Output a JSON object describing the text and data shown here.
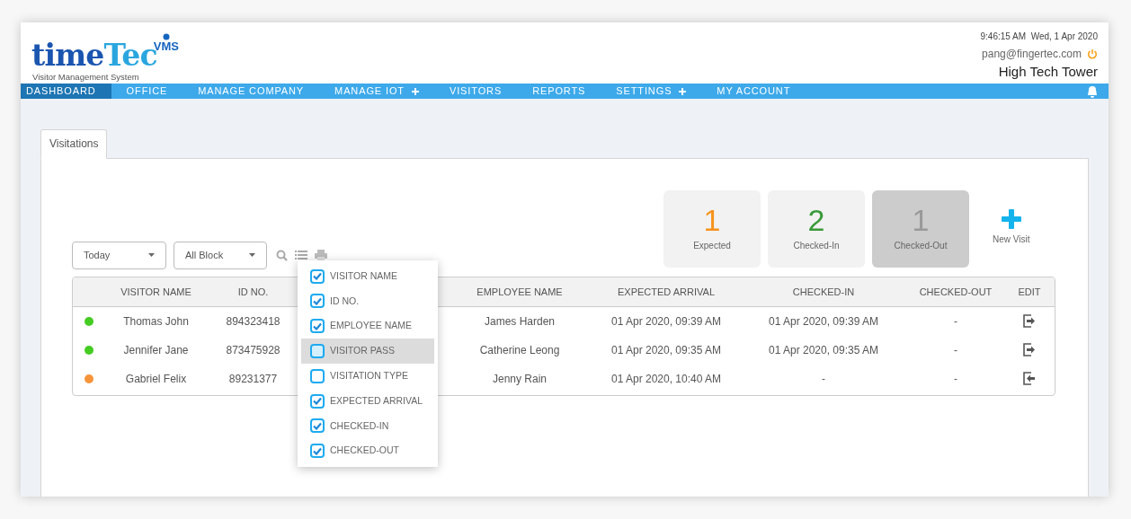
{
  "logo": {
    "word_dark": "time",
    "word_light": "Tec",
    "badge": "VMS",
    "subtitle": "Visitor Management System"
  },
  "header": {
    "datetime": "9:46:15 AM  Wed, 1 Apr 2020",
    "email": "pang@fingertec.com",
    "site": "High Tech Tower"
  },
  "nav": [
    {
      "label": "DASHBOARD",
      "selected": true,
      "expandable": false
    },
    {
      "label": "OFFICE",
      "selected": false,
      "expandable": false
    },
    {
      "label": "MANAGE COMPANY",
      "selected": false,
      "expandable": false
    },
    {
      "label": "MANAGE IOT",
      "selected": false,
      "expandable": true
    },
    {
      "label": "VISITORS",
      "selected": false,
      "expandable": false
    },
    {
      "label": "REPORTS",
      "selected": false,
      "expandable": false
    },
    {
      "label": "SETTINGS",
      "selected": false,
      "expandable": true
    },
    {
      "label": "MY ACCOUNT",
      "selected": false,
      "expandable": false
    }
  ],
  "tabs": [
    {
      "label": "Visitations",
      "selected": true
    }
  ],
  "stats": [
    {
      "count": "1",
      "label": "Expected",
      "color": "#f7931e",
      "selected": false
    },
    {
      "count": "2",
      "label": "Checked-In",
      "color": "#3a9a3a",
      "selected": false
    },
    {
      "count": "1",
      "label": "Checked-Out",
      "color": "#999999",
      "selected": true
    }
  ],
  "new_visit": {
    "label": "New Visit"
  },
  "filters": [
    {
      "value": "Today"
    },
    {
      "value": "All Block"
    }
  ],
  "table": {
    "columns": [
      "VISITOR NAME",
      "ID NO.",
      "EMPLOYEE NAME",
      "EXPECTED ARRIVAL",
      "CHECKED-IN",
      "CHECKED-OUT",
      "EDIT"
    ],
    "rows": [
      {
        "color": "#44cc22",
        "kind": "check-out",
        "cells": [
          "Thomas John",
          "894323418",
          "James Harden",
          "01 Apr 2020, 09:39 AM",
          "01 Apr 2020, 09:39 AM",
          "-"
        ]
      },
      {
        "color": "#44cc22",
        "kind": "check-out",
        "cells": [
          "Jennifer Jane",
          "873475928",
          "Catherine Leong",
          "01 Apr 2020, 09:35 AM",
          "01 Apr 2020, 09:35 AM",
          "-"
        ]
      },
      {
        "color": "#f7943a",
        "kind": "check-in",
        "cells": [
          "Gabriel Felix",
          "89231377",
          "Jenny Rain",
          "01 Apr 2020, 10:40 AM",
          "-",
          "-"
        ]
      }
    ]
  },
  "column_menu": [
    {
      "label": "VISITOR NAME",
      "checked": true,
      "highlighted": false
    },
    {
      "label": "ID NO.",
      "checked": true,
      "highlighted": false
    },
    {
      "label": "EMPLOYEE NAME",
      "checked": true,
      "highlighted": false
    },
    {
      "label": "VISITOR PASS",
      "checked": false,
      "highlighted": true
    },
    {
      "label": "VISITATION TYPE",
      "checked": false,
      "highlighted": false
    },
    {
      "label": "EXPECTED ARRIVAL",
      "checked": true,
      "highlighted": false
    },
    {
      "label": "CHECKED-IN",
      "checked": true,
      "highlighted": false
    },
    {
      "label": "CHECKED-OUT",
      "checked": true,
      "highlighted": false
    }
  ]
}
